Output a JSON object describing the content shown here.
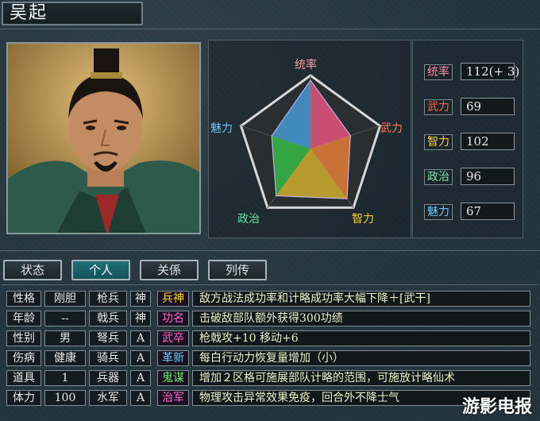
{
  "officer": {
    "name": "吴起"
  },
  "radar": {
    "labels": {
      "lead": "统率",
      "war": "武力",
      "int": "智力",
      "pol": "政治",
      "chr": "魅力"
    },
    "label_colors": {
      "lead": "#ff9ab0",
      "war": "#ff7a5a",
      "int": "#ffcc33",
      "pol": "#66e0a0",
      "chr": "#6ec6ff"
    },
    "values": {
      "lead": 112,
      "war": 69,
      "int": 102,
      "pol": 96,
      "chr": 67
    },
    "max": 120
  },
  "stats": [
    {
      "label": "统率",
      "value": "112(+ 3)",
      "color": "#ff8aa8"
    },
    {
      "label": "武力",
      "value": "69",
      "color": "#ff6a4a"
    },
    {
      "label": "智力",
      "value": "102",
      "color": "#ffd23a"
    },
    {
      "label": "政治",
      "value": "96",
      "color": "#7ae8a8"
    },
    {
      "label": "魅力",
      "value": "67",
      "color": "#6ec6ff"
    }
  ],
  "tabs": [
    "状态",
    "个人",
    "关係",
    "列传"
  ],
  "active_tab": "个人",
  "attributes": [
    {
      "k1": "性格",
      "v1": "刚胆",
      "k2": "枪兵",
      "v2": "神"
    },
    {
      "k1": "年龄",
      "v1": "--",
      "k2": "戟兵",
      "v2": "神"
    },
    {
      "k1": "性别",
      "v1": "男",
      "k2": "弩兵",
      "v2": "A"
    },
    {
      "k1": "伤病",
      "v1": "健康",
      "k2": "骑兵",
      "v2": "A"
    },
    {
      "k1": "道具",
      "v1": "1",
      "k2": "兵器",
      "v2": "A"
    },
    {
      "k1": "体力",
      "v1": "100",
      "k2": "水军",
      "v2": "A"
    }
  ],
  "skills": [
    {
      "tag": "兵神",
      "tag_color": "#ffd23a",
      "desc": "敌方战法成功率和计略成功率大幅下降＋[武干]"
    },
    {
      "tag": "功名",
      "tag_color": "#ff66cc",
      "desc": "击破敌部队额外获得300功绩"
    },
    {
      "tag": "武卒",
      "tag_color": "#ff66cc",
      "desc": "枪戟攻+10 移动+6"
    },
    {
      "tag": "革新",
      "tag_color": "#66ccff",
      "desc": "每白行动力恢复量增加（小）"
    },
    {
      "tag": "鬼谋",
      "tag_color": "#66ee66",
      "desc": "增加２区格可施展部队计略的范围，可施放计略仙术"
    },
    {
      "tag": "治军",
      "tag_color": "#ff66cc",
      "desc": "物理攻击异常效果免疫，回合外不降士气"
    }
  ],
  "watermark": "游影电报"
}
